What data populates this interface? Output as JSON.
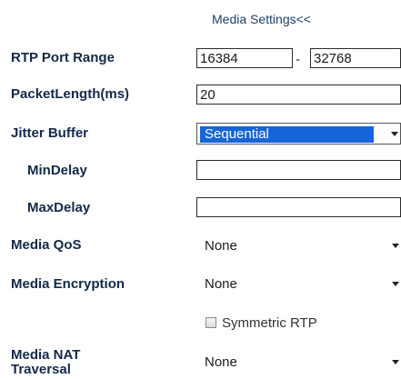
{
  "section_toggle": "Media Settings<<",
  "rtp_port_range": {
    "label": "RTP Port Range",
    "start": "16384",
    "separator": "-",
    "end": "32768"
  },
  "packet_length": {
    "label": "PacketLength(ms)",
    "value": "20"
  },
  "jitter_buffer": {
    "label": "Jitter Buffer",
    "selected": "Sequential"
  },
  "min_delay": {
    "label": "MinDelay",
    "value": ""
  },
  "max_delay": {
    "label": "MaxDelay",
    "value": ""
  },
  "media_qos": {
    "label": "Media QoS",
    "selected": "None"
  },
  "media_encryption": {
    "label": "Media Encryption",
    "selected": "None"
  },
  "symmetric_rtp": {
    "label": "Symmetric RTP",
    "checked": false
  },
  "media_nat": {
    "label_line1": "Media NAT",
    "label_line2": "Traversal",
    "selected": "None"
  },
  "icons": {
    "dropdown": "chevron-down-icon"
  },
  "colors": {
    "label": "#13294b",
    "link": "#1f3f6e",
    "selection": "#1565d8"
  }
}
